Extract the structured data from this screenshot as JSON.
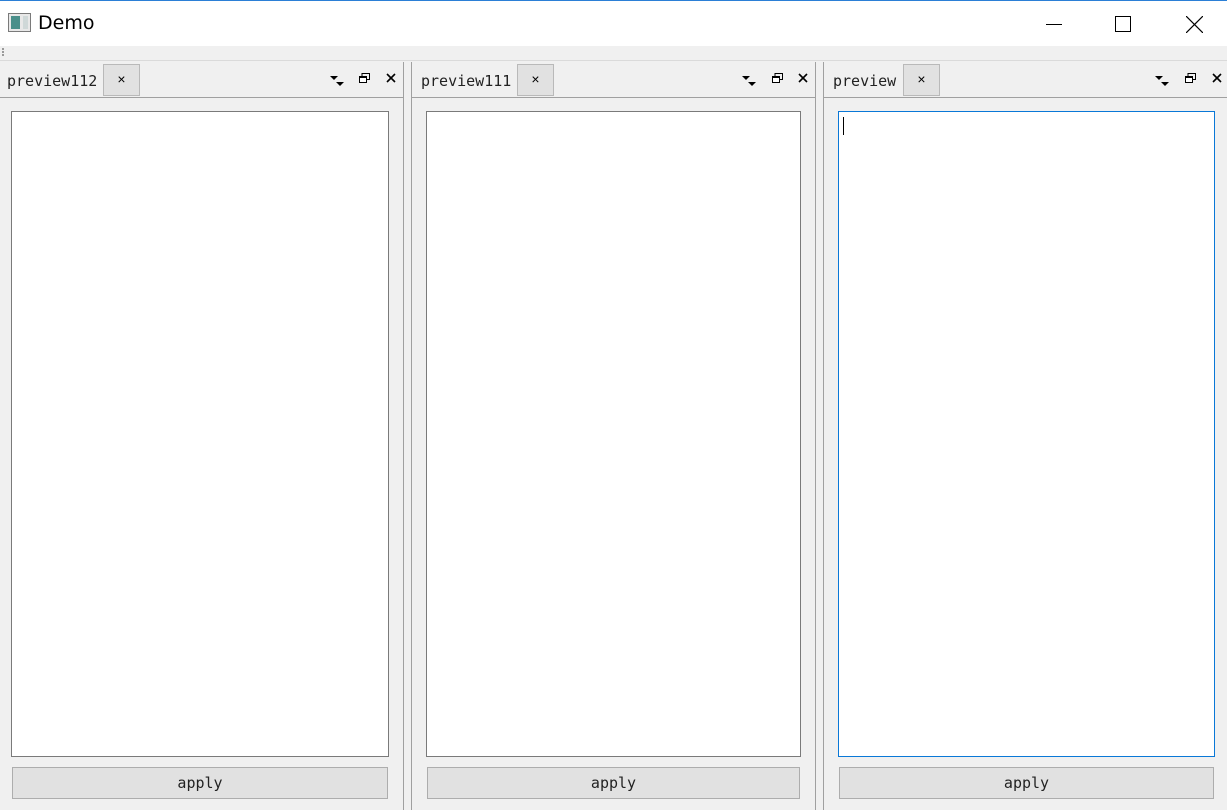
{
  "window": {
    "title": "Demo",
    "minimize_glyph": "—",
    "maximize_glyph": "☐",
    "close_glyph": "✕"
  },
  "docks": [
    {
      "tab_title": "preview112",
      "tab_close_glyph": "×",
      "apply_label": "apply"
    },
    {
      "tab_title": "preview111",
      "tab_close_glyph": "×",
      "apply_label": "apply"
    },
    {
      "tab_title": "preview",
      "tab_close_glyph": "×",
      "apply_label": "apply",
      "focused": true
    }
  ],
  "colors": {
    "focus_border": "#0a78d7",
    "title_border": "#2b7fd6",
    "button_bg": "#e1e1e1"
  }
}
